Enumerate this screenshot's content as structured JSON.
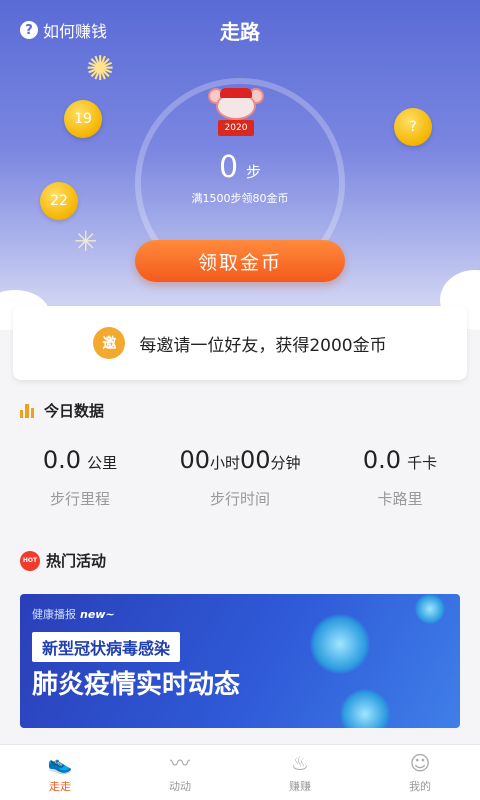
{
  "header": {
    "help_label": "如何赚钱",
    "title": "走路"
  },
  "hero": {
    "mascot_year": "2020",
    "steps_value": "0",
    "steps_unit": "步",
    "goal_text": "满1500步领80金币",
    "coins": [
      "19",
      "22",
      "?"
    ],
    "claim_button": "领取金币"
  },
  "invite": {
    "icon_text": "邀",
    "text": "每邀请一位好友，获得2000金币"
  },
  "today": {
    "heading": "今日数据",
    "stats": [
      {
        "value": "0.0",
        "unit": "公里",
        "label": "步行里程"
      },
      {
        "value_hours": "00",
        "unit_hours": "小时",
        "value_minutes": "00",
        "unit_minutes": "分钟",
        "label": "步行时间"
      },
      {
        "value": "0.0",
        "unit": "千卡",
        "label": "卡路里"
      }
    ]
  },
  "hot": {
    "badge": "HOT",
    "heading": "热门活动",
    "banner": {
      "kicker": "健康播报",
      "kicker_tag": "new~",
      "subtitle": "新型冠状病毒感染",
      "title": "肺炎疫情实时动态"
    }
  },
  "tabbar": {
    "items": [
      {
        "label": "走走",
        "icon": "shoe-icon",
        "active": true
      },
      {
        "label": "动动",
        "icon": "run-icon",
        "active": false
      },
      {
        "label": "赚赚",
        "icon": "money-bag-icon",
        "active": false
      },
      {
        "label": "我的",
        "icon": "smile-icon",
        "active": false
      }
    ]
  },
  "colors": {
    "accent": "#f06020",
    "hero_top": "#5a6bd6",
    "coin": "#f5b400"
  }
}
